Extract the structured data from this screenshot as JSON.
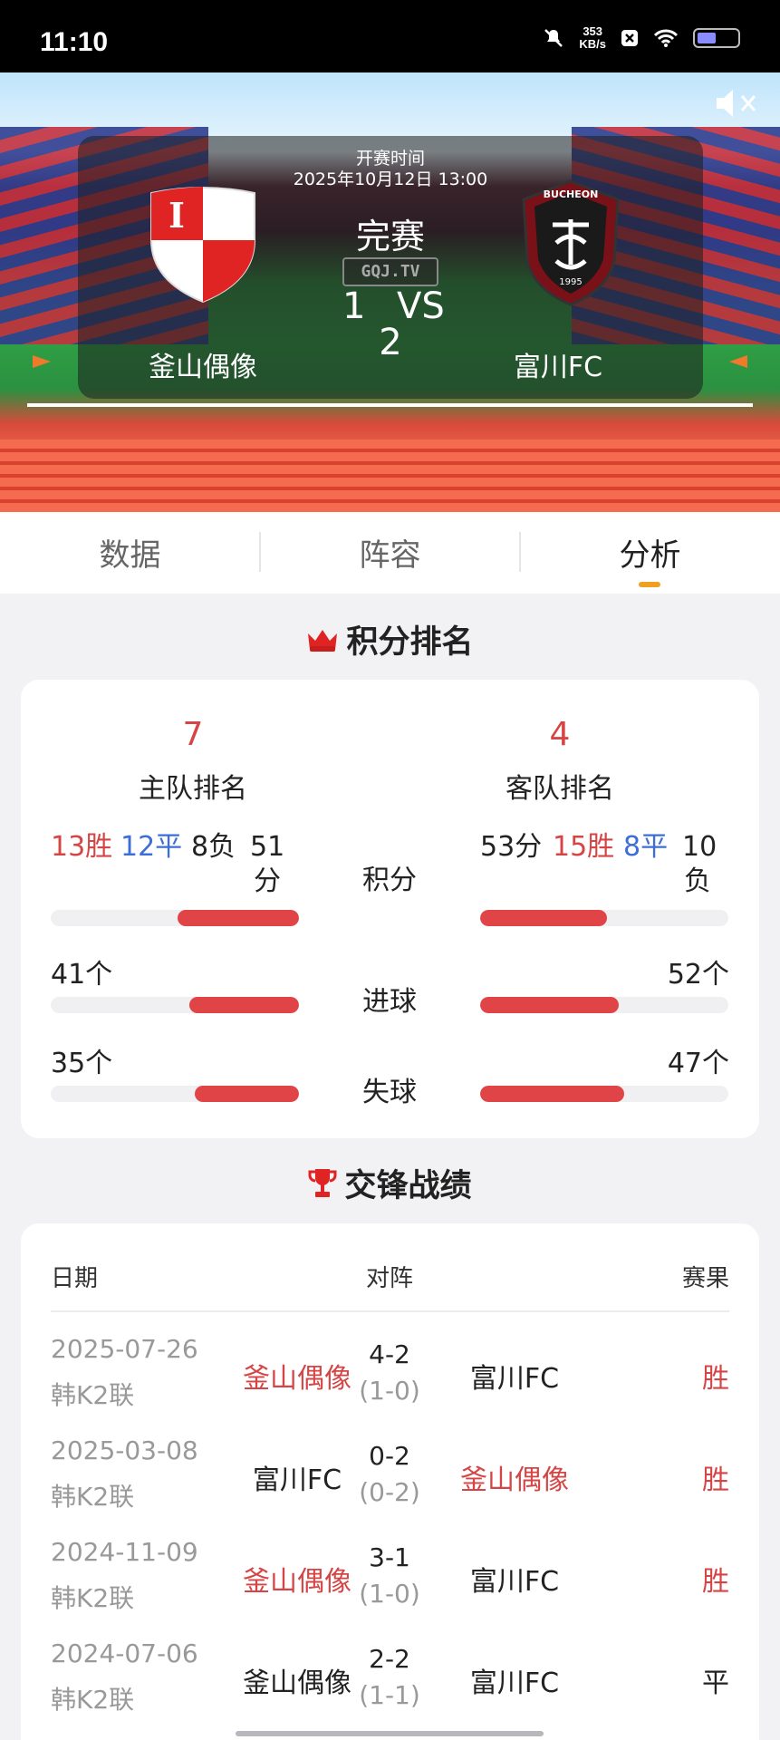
{
  "status_bar": {
    "time": "11:10",
    "net_speed": "353",
    "net_unit": "KB/s",
    "icons": [
      "mute-icon",
      "close-box-icon",
      "wifi-icon",
      "battery-icon"
    ]
  },
  "match": {
    "kickoff_label": "开赛时间",
    "kickoff_time": "2025年10月12日  13:00",
    "status": "完赛",
    "watermark": "GQJ.TV",
    "home_score": "1",
    "vs": "VS",
    "away_score": "2",
    "home_team": "釜山偶像",
    "away_team": "富川FC",
    "home_logo_letter": "I",
    "away_logo_text": "BUCHEON",
    "away_logo_year": "1995"
  },
  "tabs": [
    {
      "label": "数据",
      "active": false
    },
    {
      "label": "阵容",
      "active": false
    },
    {
      "label": "分析",
      "active": true
    }
  ],
  "ranking": {
    "title": "积分排名",
    "home_rank": "7",
    "home_rank_label": "主队排名",
    "away_rank": "4",
    "away_rank_label": "客队排名",
    "home_record": {
      "wins": "13胜",
      "draws": "12平",
      "losses": "8负",
      "points": "51",
      "points_unit": "分"
    },
    "away_record": {
      "points": "53分",
      "wins": "15胜",
      "draws": "8平",
      "losses": "10",
      "losses_unit": "负"
    },
    "labels": {
      "points": "积分",
      "goals_for": "进球",
      "goals_against": "失球"
    },
    "home_goals_for": "41个",
    "away_goals_for": "52个",
    "home_goals_against": "35个",
    "away_goals_against": "47个",
    "bars": {
      "points": {
        "home": 0.49,
        "away": 0.51
      },
      "goals_for": {
        "home": 0.44,
        "away": 0.56
      },
      "goals_against": {
        "home": 0.42,
        "away": 0.58
      }
    },
    "accent": "#e04446"
  },
  "h2h": {
    "title": "交锋战绩",
    "headers": {
      "date": "日期",
      "match": "对阵",
      "result": "赛果"
    },
    "rows": [
      {
        "date": "2025-07-26",
        "comp": "韩K2联",
        "home": "釜山偶像",
        "home_highlight": true,
        "ft": "4-2",
        "ht": "(1-0)",
        "away": "富川FC",
        "away_highlight": false,
        "result": "胜",
        "result_color": "#d64545"
      },
      {
        "date": "2025-03-08",
        "comp": "韩K2联",
        "home": "富川FC",
        "home_highlight": false,
        "ft": "0-2",
        "ht": "(0-2)",
        "away": "釜山偶像",
        "away_highlight": true,
        "result": "胜",
        "result_color": "#d64545"
      },
      {
        "date": "2024-11-09",
        "comp": "韩K2联",
        "home": "釜山偶像",
        "home_highlight": true,
        "ft": "3-1",
        "ht": "(1-0)",
        "away": "富川FC",
        "away_highlight": false,
        "result": "胜",
        "result_color": "#d64545"
      },
      {
        "date": "2024-07-06",
        "comp": "韩K2联",
        "home": "釜山偶像",
        "home_highlight": false,
        "ft": "2-2",
        "ht": "(1-1)",
        "away": "富川FC",
        "away_highlight": false,
        "result": "平",
        "result_color": "#222222"
      }
    ]
  }
}
